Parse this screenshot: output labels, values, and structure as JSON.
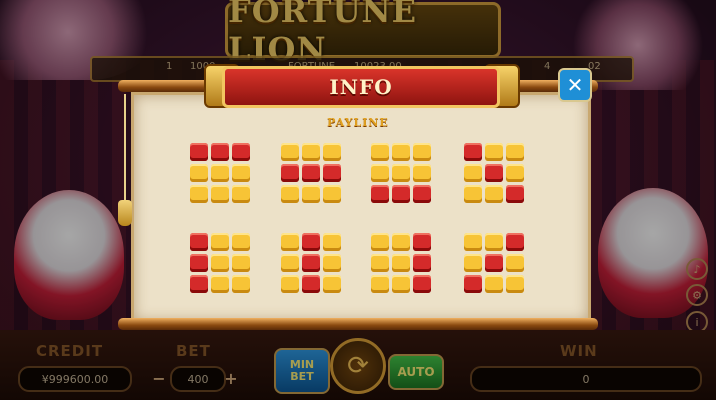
{
  "logo": {
    "text": "FORTUNE LION"
  },
  "info": {
    "title": "INFO",
    "subtitle": "PAYLINE",
    "close_glyph": "✕"
  },
  "top_bar": {
    "items": [
      "1",
      "1000",
      "FORTUNE",
      "10023.00",
      "4",
      "02"
    ]
  },
  "paylines": [
    [
      1,
      1,
      1,
      0,
      0,
      0,
      0,
      0,
      0
    ],
    [
      0,
      0,
      0,
      1,
      1,
      1,
      0,
      0,
      0
    ],
    [
      0,
      0,
      0,
      0,
      0,
      0,
      1,
      1,
      1
    ],
    [
      1,
      0,
      0,
      0,
      1,
      0,
      0,
      0,
      1
    ],
    [
      1,
      0,
      0,
      1,
      0,
      0,
      1,
      0,
      0
    ],
    [
      0,
      1,
      0,
      0,
      1,
      0,
      0,
      1,
      0
    ],
    [
      0,
      0,
      1,
      0,
      0,
      1,
      0,
      0,
      1
    ],
    [
      0,
      0,
      1,
      0,
      1,
      0,
      1,
      0,
      0
    ]
  ],
  "bottom": {
    "credit_label": "CREDIT",
    "credit_value": "¥999600.00",
    "bet_label": "BET",
    "bet_value": "400",
    "minus": "−",
    "plus": "+",
    "min_bet_label_1": "MIN",
    "min_bet_label_2": "BET",
    "spin_glyph": "⟳",
    "auto_label": "AUTO",
    "win_label": "WIN",
    "win_value": "0"
  },
  "side_icons": [
    "speaker-icon",
    "gear-icon",
    "info-icon",
    "chevron-down-icon"
  ],
  "colors": {
    "payline_on": "#d42a2a",
    "payline_off": "#f7c436",
    "banner": "#d9342a",
    "close": "#1f8fd6"
  }
}
